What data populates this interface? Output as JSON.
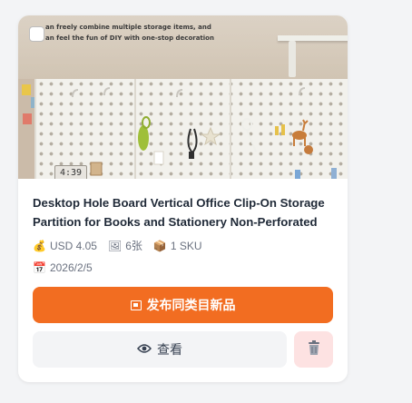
{
  "product": {
    "image_caption_line1": "an freely combine multiple storage items, and",
    "image_caption_line2": "an feel the fun of DIY with one-stop decoration",
    "clock_text": "4:39",
    "title": "Desktop Hole Board Vertical Office Clip-On Storage Partition for Books and Stationery Non-Perforated",
    "price": "USD 4.05",
    "image_count": "6张",
    "sku_count": "1 SKU",
    "date": "2026/2/5"
  },
  "icons": {
    "price": "money-bag-icon",
    "images": "picture-icon",
    "sku": "package-icon",
    "date": "calendar-icon",
    "publish": "window-icon",
    "view": "eye-icon",
    "delete": "trash-icon"
  },
  "actions": {
    "publish_label": "发布同类目新品",
    "view_label": "查看"
  },
  "colors": {
    "primary": "#f26d21",
    "delete_bg": "#fde2e2",
    "view_bg": "#f3f4f6",
    "page_bg": "#f3f4f6"
  }
}
